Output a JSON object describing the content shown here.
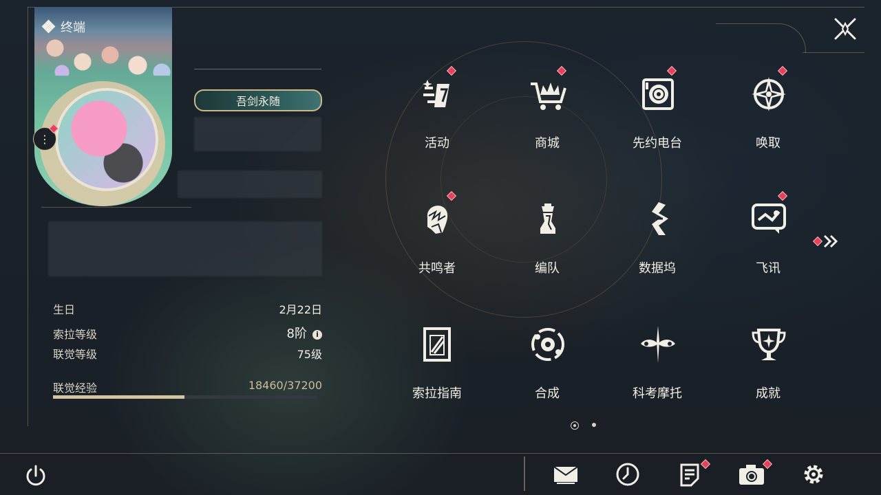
{
  "header": {
    "title": "终端"
  },
  "profile": {
    "title_badge": "吾剑永随",
    "stats": [
      {
        "label": "生日",
        "value": "2月22日"
      },
      {
        "label": "索拉等级",
        "value": "8阶"
      },
      {
        "label": "联觉等级",
        "value": "75级"
      }
    ],
    "exp": {
      "label": "联觉经验",
      "value": "18460/37200",
      "current": 18460,
      "max": 37200
    }
  },
  "menu": [
    {
      "label": "活动",
      "icon": "activity-icon",
      "badge": true
    },
    {
      "label": "商城",
      "icon": "shop-crown-cart-icon",
      "badge": true
    },
    {
      "label": "先约电台",
      "icon": "radio-disc-icon",
      "badge": true
    },
    {
      "label": "唤取",
      "icon": "compass-star-icon",
      "badge": true
    },
    {
      "label": "共鸣者",
      "icon": "character-head-icon",
      "badge": true
    },
    {
      "label": "编队",
      "icon": "chess-piece-icon",
      "badge": false
    },
    {
      "label": "数据坞",
      "icon": "data-dock-icon",
      "badge": false
    },
    {
      "label": "飞讯",
      "icon": "chat-bubble-icon",
      "badge": true
    },
    {
      "label": "索拉指南",
      "icon": "guide-book-icon",
      "badge": false
    },
    {
      "label": "合成",
      "icon": "synthesis-orbit-icon",
      "badge": false
    },
    {
      "label": "科考摩托",
      "icon": "motorbike-star-icon",
      "badge": false
    },
    {
      "label": "成就",
      "icon": "trophy-icon",
      "badge": false
    }
  ],
  "pagination": {
    "current": 1,
    "total": 2
  },
  "bottom_bar": {
    "left": [
      "power-icon"
    ],
    "right": [
      {
        "icon": "mail-icon",
        "badge": false
      },
      {
        "icon": "clock-icon",
        "badge": false
      },
      {
        "icon": "notes-icon",
        "badge": true
      },
      {
        "icon": "camera-icon",
        "badge": true
      },
      {
        "icon": "settings-gear-icon",
        "badge": false
      }
    ]
  },
  "colors": {
    "accent_gold": "#cdb88a",
    "badge_red": "#e4425a",
    "text": "#f1eee6",
    "exp_fill": "#d3c4a4"
  }
}
